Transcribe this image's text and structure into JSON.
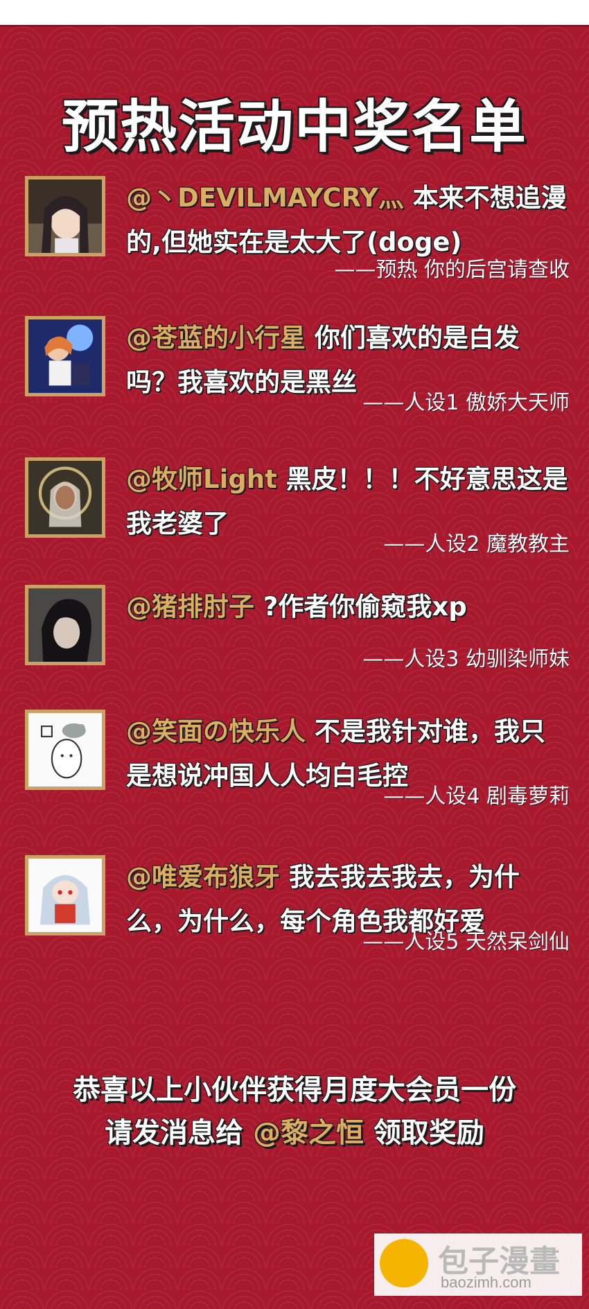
{
  "title": "预热活动中奖名单",
  "entries": [
    {
      "handle": "@丶DEVILMAYCRY灬",
      "text": "本来不想追漫的,但她实在是太大了(doge)",
      "signature": "——预热 你的后宫请查收"
    },
    {
      "handle": "@苍蓝的小行星",
      "text": "你们喜欢的是白发吗？我喜欢的是黑丝",
      "signature": "——人设1 傲娇大天师"
    },
    {
      "handle": "@牧师Light",
      "text": "黑皮！！！不好意思这是我老婆了",
      "signature": "——人设2 魔教教主"
    },
    {
      "handle": "@猪排肘子",
      "text": "?作者你偷窥我xp",
      "signature": "——人设3 幼驯染师妹"
    },
    {
      "handle": "@笑面の快乐人",
      "text": "不是我针对谁，我只是想说冲国人人均白毛控",
      "signature": "——人设4 剧毒萝莉"
    },
    {
      "handle": "@唯爱布狼牙",
      "text": "我去我去我去，为什么，为什么，每个角色我都好爱",
      "signature": "——人设5 天然呆剑仙"
    }
  ],
  "footer": {
    "line1": "恭喜以上小伙伴获得月度大会员一份",
    "line2_pre": "请发消息给",
    "line2_handle": "@黎之恒",
    "line2_post": "领取奖励"
  },
  "watermark": {
    "name": "包子漫畫",
    "url": "baozimh.com"
  }
}
